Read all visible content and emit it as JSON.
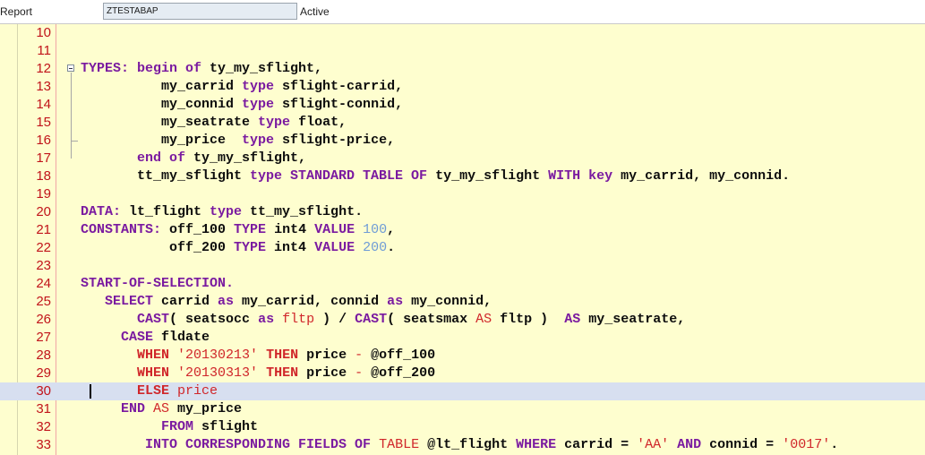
{
  "header": {
    "report_label": "Report",
    "report_name": "ZTESTABAP",
    "status": "Active"
  },
  "editor": {
    "current_line": 30,
    "lines": [
      {
        "n": "10",
        "segs": []
      },
      {
        "n": "11",
        "segs": []
      },
      {
        "n": "12",
        "segs": [
          [
            "kw",
            "TYPES: begin of "
          ],
          [
            "",
            "ty_my_sflight,"
          ]
        ]
      },
      {
        "n": "13",
        "segs": [
          [
            "",
            "          my_carrid "
          ],
          [
            "kw",
            "type "
          ],
          [
            "",
            "sflight-carrid,"
          ]
        ]
      },
      {
        "n": "14",
        "segs": [
          [
            "",
            "          my_connid "
          ],
          [
            "kw",
            "type "
          ],
          [
            "",
            "sflight-connid,"
          ]
        ]
      },
      {
        "n": "15",
        "segs": [
          [
            "",
            "          my_seatrate "
          ],
          [
            "kw",
            "type "
          ],
          [
            "",
            "float,"
          ]
        ]
      },
      {
        "n": "16",
        "segs": [
          [
            "",
            "          my_price  "
          ],
          [
            "kw",
            "type "
          ],
          [
            "",
            "sflight-price,"
          ]
        ]
      },
      {
        "n": "17",
        "segs": [
          [
            "kw",
            "       end of "
          ],
          [
            "",
            "ty_my_sflight,"
          ]
        ]
      },
      {
        "n": "18",
        "segs": [
          [
            "",
            "       tt_my_sflight "
          ],
          [
            "kw",
            "type STANDARD TABLE OF "
          ],
          [
            "",
            "ty_my_sflight "
          ],
          [
            "kw",
            "WITH key "
          ],
          [
            "",
            "my_carrid, my_connid."
          ]
        ]
      },
      {
        "n": "19",
        "segs": []
      },
      {
        "n": "20",
        "segs": [
          [
            "kw",
            "DATA: "
          ],
          [
            "",
            "lt_flight "
          ],
          [
            "kw",
            "type "
          ],
          [
            "",
            "tt_my_sflight."
          ]
        ]
      },
      {
        "n": "21",
        "segs": [
          [
            "kw",
            "CONSTANTS: "
          ],
          [
            "",
            "off_100 "
          ],
          [
            "kw",
            "TYPE "
          ],
          [
            "",
            "int4 "
          ],
          [
            "kw",
            "VALUE "
          ],
          [
            "num",
            "100"
          ],
          [
            "",
            ","
          ]
        ]
      },
      {
        "n": "22",
        "segs": [
          [
            "",
            "           off_200 "
          ],
          [
            "kw",
            "TYPE "
          ],
          [
            "",
            "int4 "
          ],
          [
            "kw",
            "VALUE "
          ],
          [
            "num",
            "200"
          ],
          [
            "",
            "."
          ]
        ]
      },
      {
        "n": "23",
        "segs": []
      },
      {
        "n": "24",
        "segs": [
          [
            "kw",
            "START-OF-SELECTION."
          ]
        ]
      },
      {
        "n": "25",
        "segs": [
          [
            "kw",
            "   SELECT "
          ],
          [
            "",
            "carrid "
          ],
          [
            "kw",
            "as "
          ],
          [
            "",
            "my_carrid, connid "
          ],
          [
            "kw",
            "as "
          ],
          [
            "",
            "my_connid,"
          ]
        ]
      },
      {
        "n": "26",
        "segs": [
          [
            "kw",
            "       CAST"
          ],
          [
            "",
            "( seatsocc "
          ],
          [
            "kw",
            "as "
          ],
          [
            "red",
            "fltp"
          ],
          [
            "",
            " ) / "
          ],
          [
            "kw",
            "CAST"
          ],
          [
            "",
            "( seatsmax "
          ],
          [
            "red",
            "AS "
          ],
          [
            "",
            "fltp )  "
          ],
          [
            "kw",
            "AS "
          ],
          [
            "",
            "my_seatrate,"
          ]
        ]
      },
      {
        "n": "27",
        "segs": [
          [
            "kw",
            "     CASE "
          ],
          [
            "",
            "fldate"
          ]
        ]
      },
      {
        "n": "28",
        "segs": [
          [
            "redb",
            "       WHEN "
          ],
          [
            "red",
            "'20130213' "
          ],
          [
            "redb",
            "THEN "
          ],
          [
            "",
            "price "
          ],
          [
            "red",
            "- "
          ],
          [
            "",
            "@off_100"
          ]
        ]
      },
      {
        "n": "29",
        "segs": [
          [
            "redb",
            "       WHEN "
          ],
          [
            "red",
            "'20130313' "
          ],
          [
            "redb",
            "THEN "
          ],
          [
            "",
            "price "
          ],
          [
            "red",
            "- "
          ],
          [
            "",
            "@off_200"
          ]
        ]
      },
      {
        "n": "30",
        "segs": [
          [
            "redb",
            "       ELSE "
          ],
          [
            "red",
            "price"
          ]
        ]
      },
      {
        "n": "31",
        "segs": [
          [
            "kw",
            "     END "
          ],
          [
            "red",
            "AS "
          ],
          [
            "",
            "my_price"
          ]
        ]
      },
      {
        "n": "32",
        "segs": [
          [
            "kw",
            "          FROM "
          ],
          [
            "",
            "sflight"
          ]
        ]
      },
      {
        "n": "33",
        "segs": [
          [
            "kw",
            "        INTO CORRESPONDING FIELDS OF "
          ],
          [
            "red",
            "TABLE "
          ],
          [
            "",
            "@lt_flight "
          ],
          [
            "kw",
            "WHERE "
          ],
          [
            "",
            "carrid = "
          ],
          [
            "red",
            "'AA' "
          ],
          [
            "kw",
            "AND "
          ],
          [
            "",
            "connid = "
          ],
          [
            "red",
            "'0017'"
          ],
          [
            "",
            "."
          ]
        ]
      }
    ]
  }
}
